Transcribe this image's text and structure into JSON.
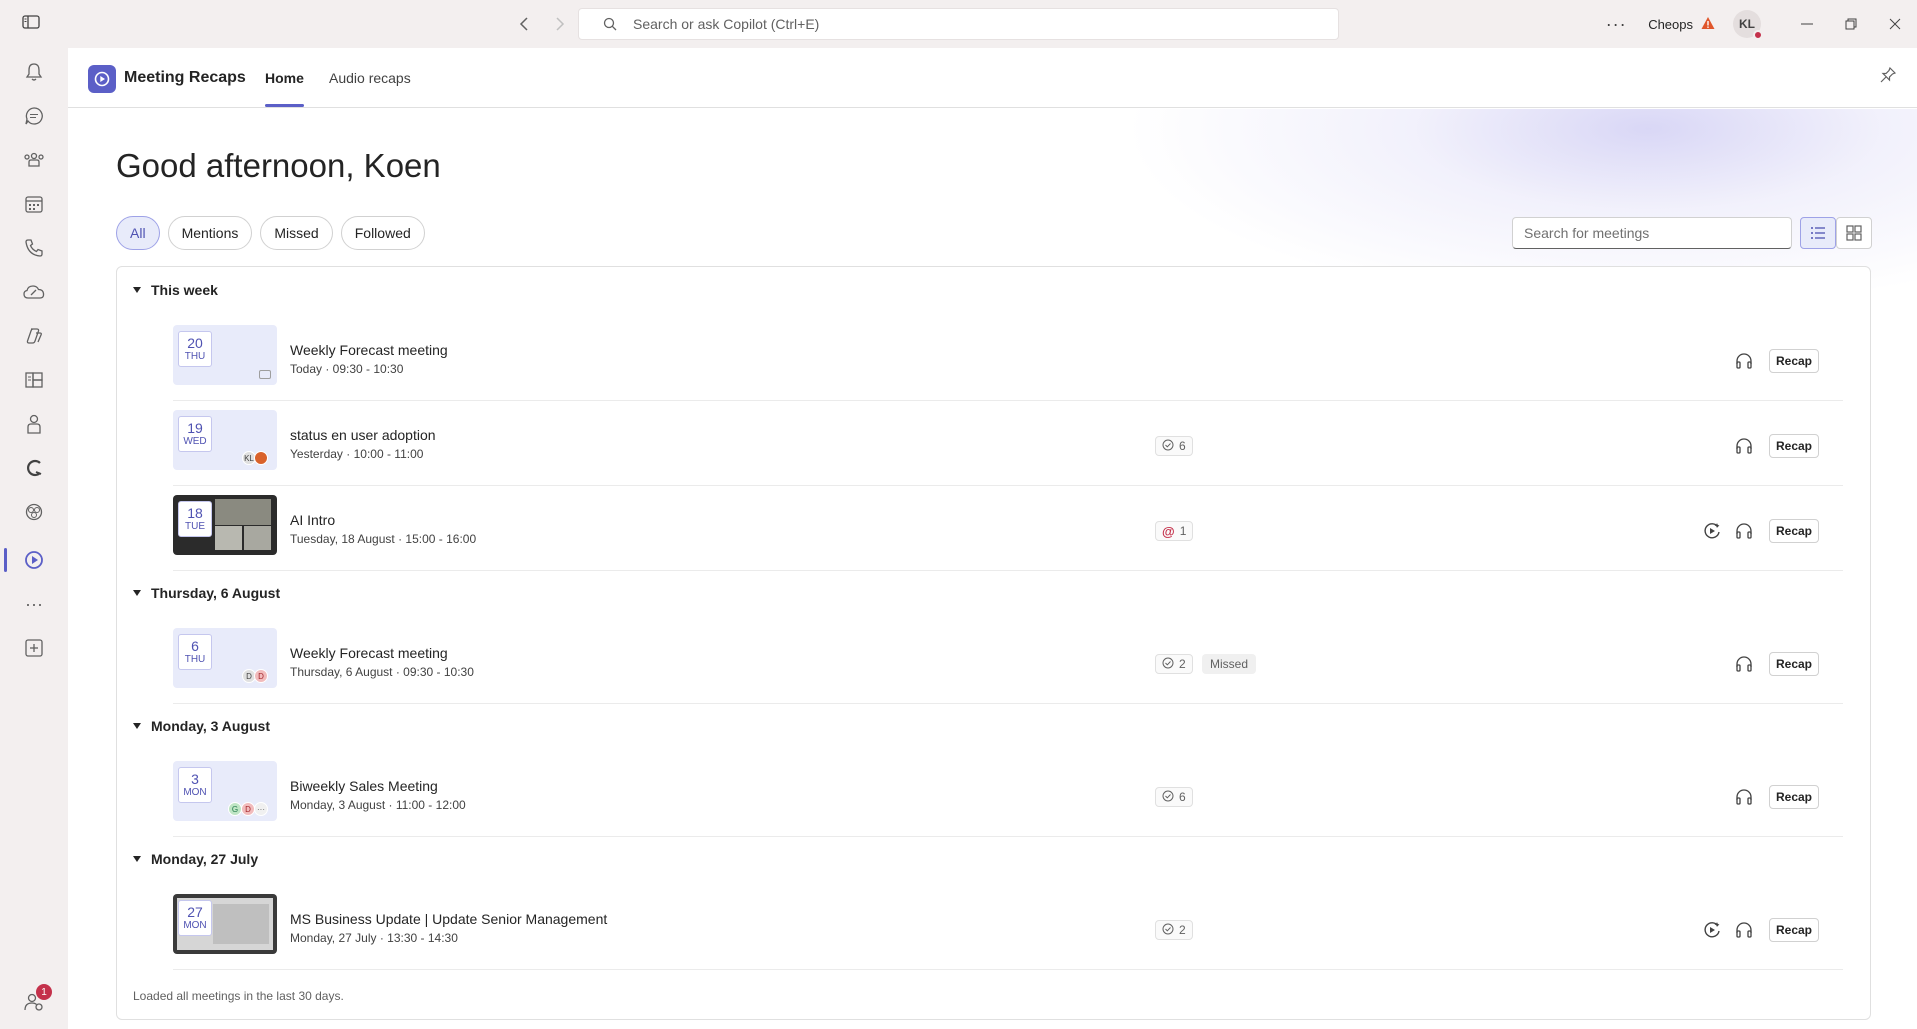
{
  "titlebar": {
    "search_placeholder": "Search or ask Copilot (Ctrl+E)",
    "org_name": "Cheops",
    "avatar_initials": "KL",
    "more": "···"
  },
  "rail": {
    "items": [
      "activity",
      "chat",
      "teams",
      "calendar",
      "calls",
      "onedrive",
      "copilot",
      "apps",
      "people",
      "loop",
      "viva",
      "meeting-recaps",
      "more-apps",
      "add-app",
      "notifications-people"
    ],
    "more": "···",
    "badge_count": "1"
  },
  "app": {
    "name": "Meeting Recaps",
    "tabs": [
      {
        "label": "Home",
        "active": true
      },
      {
        "label": "Audio recaps",
        "active": false
      }
    ],
    "accent": "#5b5fc7"
  },
  "main": {
    "greeting": "Good afternoon, Koen",
    "filters": [
      "All",
      "Mentions",
      "Missed",
      "Followed"
    ],
    "active_filter": "All",
    "search_placeholder": "Search for meetings",
    "footer": "Loaded all meetings in the last 30 days."
  },
  "groups": [
    {
      "label": "This week"
    },
    {
      "label": "Thursday, 6 August"
    },
    {
      "label": "Monday, 3 August"
    },
    {
      "label": "Monday, 27 July"
    }
  ],
  "meetings": [
    {
      "day": "20",
      "weekday": "THU",
      "title": "Weekly Forecast meeting",
      "time": "Today · 09:30 - 10:30",
      "stat": "",
      "missed": "",
      "recap": "Recap"
    },
    {
      "day": "19",
      "weekday": "WED",
      "title": "status en user adoption",
      "time": "Yesterday · 10:00 - 11:00",
      "stat": "6",
      "missed": "",
      "avatars": [
        "KL"
      ],
      "recap": "Recap"
    },
    {
      "day": "18",
      "weekday": "TUE",
      "title": "AI Intro",
      "time": "Tuesday, 18 August · 15:00 - 16:00",
      "stat": "1",
      "stat_icon": "mention-icon",
      "missed": "",
      "recap": "Recap"
    },
    {
      "day": "6",
      "weekday": "THU",
      "title": "Weekly Forecast meeting",
      "time": "Thursday, 6 August · 09:30 - 10:30",
      "stat": "2",
      "missed": "Missed",
      "avatars": [
        "D",
        "D"
      ],
      "recap": "Recap"
    },
    {
      "day": "3",
      "weekday": "MON",
      "title": "Biweekly  Sales Meeting",
      "time": "Monday, 3 August · 11:00 - 12:00",
      "stat": "6",
      "missed": "",
      "avatars": [
        "G",
        "D",
        "···"
      ],
      "recap": "Recap"
    },
    {
      "day": "27",
      "weekday": "MON",
      "title": "MS Business Update | Update Senior Management",
      "time": "Monday, 27 July · 13:30 - 14:30",
      "stat": "2",
      "missed": "",
      "recap": "Recap"
    }
  ]
}
